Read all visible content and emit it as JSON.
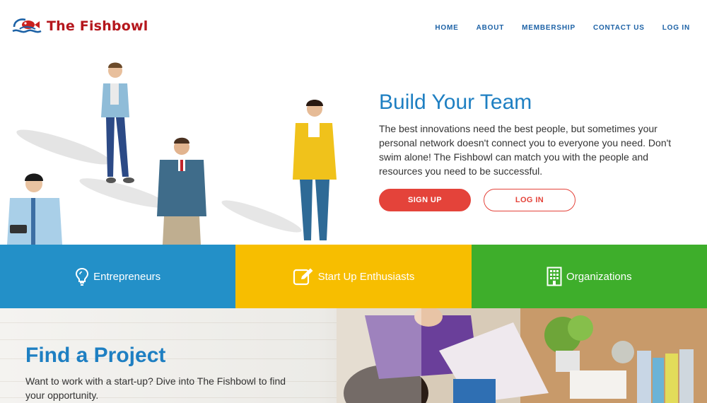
{
  "header": {
    "brand": "The Fishbowl",
    "nav": [
      {
        "label": "HOME"
      },
      {
        "label": "ABOUT"
      },
      {
        "label": "MEMBERSHIP"
      },
      {
        "label": "CONTACT US"
      },
      {
        "label": "LOG IN"
      }
    ]
  },
  "hero": {
    "title": "Build Your Team",
    "text": "The best innovations need the best people, but sometimes your personal network doesn't connect you to everyone you need. Don't swim alone! The Fishbowl can match you with the people and resources you need to be successful.",
    "signup_label": "SIGN UP",
    "login_label": "LOG IN"
  },
  "categories": [
    {
      "label": "Entrepreneurs",
      "icon": "lightbulb-icon",
      "color": "#2390c8"
    },
    {
      "label": "Start Up Enthusiasts",
      "icon": "edit-icon",
      "color": "#f7be00"
    },
    {
      "label": "Organizations",
      "icon": "building-icon",
      "color": "#3eae2b"
    }
  ],
  "project": {
    "title": "Find a Project",
    "text": "Want to work with a start-up? Dive into The Fishbowl to find your opportunity."
  },
  "colors": {
    "accent_blue": "#1e7fc2",
    "brand_red": "#b5171d",
    "button_red": "#e4433a",
    "nav_blue": "#1d62a6"
  }
}
